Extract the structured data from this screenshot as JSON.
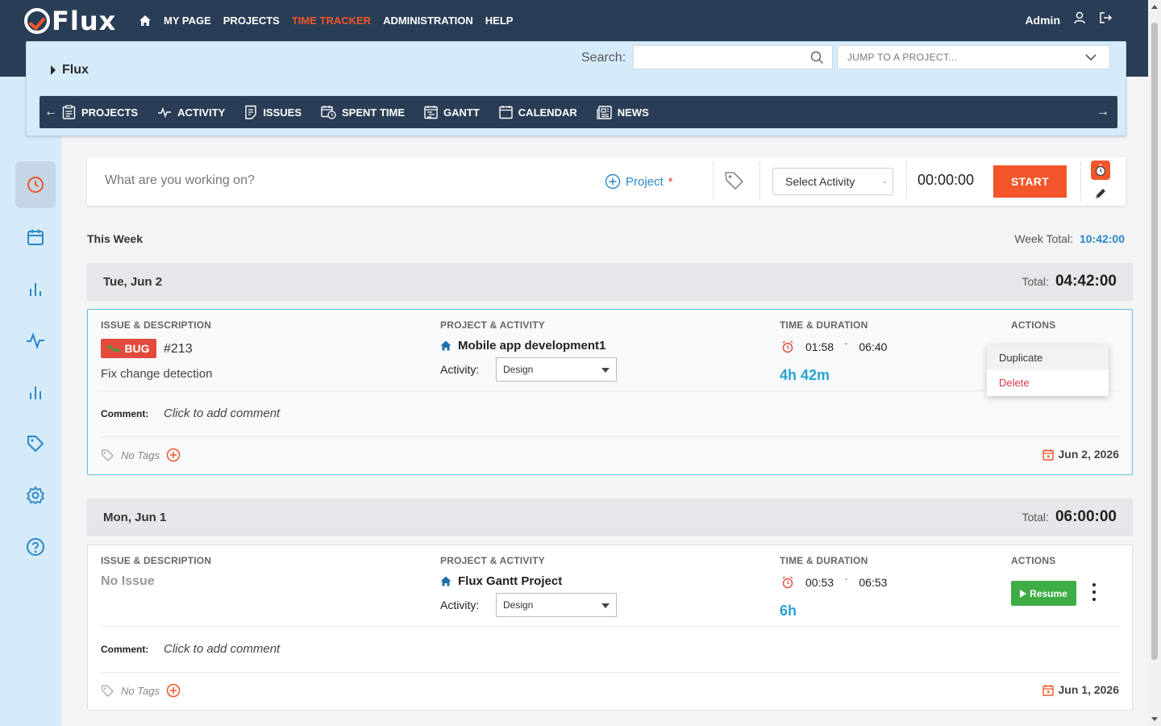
{
  "app": {
    "logo_text": "Flux",
    "user": "Admin"
  },
  "topnav": [
    {
      "label": "MY PAGE",
      "active": false
    },
    {
      "label": "PROJECTS",
      "active": false
    },
    {
      "label": "TIME TRACKER",
      "active": true
    },
    {
      "label": "ADMINISTRATION",
      "active": false
    },
    {
      "label": "HELP",
      "active": false
    }
  ],
  "project_panel": {
    "title": "Flux",
    "search_label": "Search:",
    "search_value": "",
    "jump_placeholder": "JUMP TO A PROJECT..."
  },
  "subnav": [
    {
      "label": "PROJECTS",
      "icon": "clipboard-icon"
    },
    {
      "label": "ACTIVITY",
      "icon": "pulse-icon"
    },
    {
      "label": "ISSUES",
      "icon": "issues-icon"
    },
    {
      "label": "SPENT TIME",
      "icon": "spent-time-icon"
    },
    {
      "label": "GANTT",
      "icon": "gantt-icon"
    },
    {
      "label": "CALENDAR",
      "icon": "calendar-icon"
    },
    {
      "label": "NEWS",
      "icon": "news-icon"
    }
  ],
  "sidebar": [
    "clock-icon",
    "calendar-icon",
    "bar-chart-icon",
    "pulse-icon",
    "bar-chart-icon",
    "tag-icon",
    "gear-icon",
    "help-icon"
  ],
  "timer": {
    "placeholder": "What are you working on?",
    "project_label": "Project",
    "required_mark": "*",
    "activity_placeholder": "Select Activity",
    "time": "00:00:00",
    "start_label": "START"
  },
  "week": {
    "label": "This Week",
    "total_label": "Week Total:",
    "total_value": "10:42:00"
  },
  "labels": {
    "col_issue": "ISSUE & DESCRIPTION",
    "col_project": "PROJECT & ACTIVITY",
    "col_time": "TIME & DURATION",
    "col_actions": "ACTIONS",
    "activity": "Activity:",
    "comment": "Comment:",
    "comment_placeholder": "Click to add comment",
    "no_tags": "No Tags",
    "total": "Total:"
  },
  "days": [
    {
      "label": "Tue, Jun 2",
      "total": "04:42:00",
      "entry": {
        "tracker": "BUG",
        "issue_no": "#213",
        "description": "Fix change detection",
        "project": "Mobile app development1",
        "activity": "Design",
        "start": "01:58",
        "end": "06:40",
        "duration": "4h 42m",
        "date": "Jun 2, 2026"
      }
    },
    {
      "label": "Mon, Jun 1",
      "total": "06:00:00",
      "entry": {
        "no_issue": "No Issue",
        "project": "Flux Gantt Project",
        "activity": "Design",
        "start": "00:53",
        "end": "06:53",
        "duration": "6h",
        "date": "Jun 1, 2026",
        "resume_label": "Resume"
      }
    }
  ],
  "dropdown": {
    "duplicate": "Duplicate",
    "delete": "Delete"
  },
  "colors": {
    "header": "#2a3d56",
    "accent": "#f2562a",
    "link": "#2b87c8",
    "duration": "#2aa3cf",
    "resume": "#3fad46",
    "bug": "#e34a3d"
  }
}
